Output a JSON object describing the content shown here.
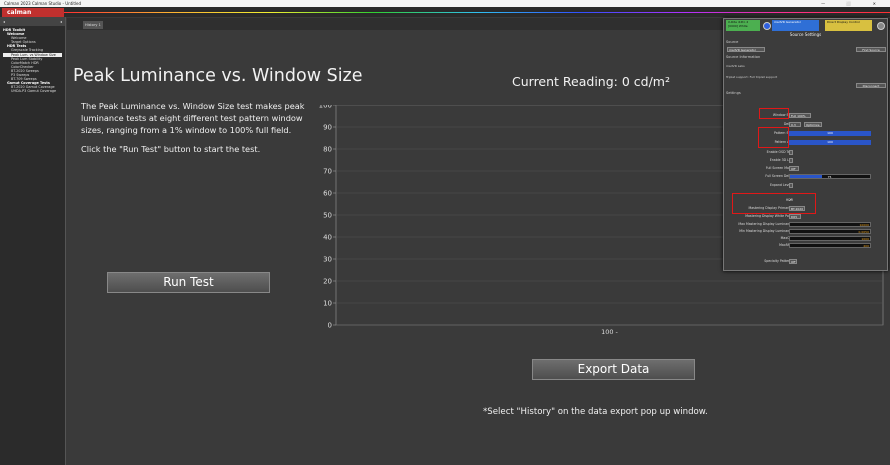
{
  "app": {
    "title": "Calman 2023 Calman Studio - Untitled",
    "logo": "calman",
    "window_controls": "— ⬜ ✕"
  },
  "sidebar": {
    "header": "HDR Toolkit",
    "items": [
      {
        "label": "HDR Toolkit",
        "level": 0,
        "bold": true
      },
      {
        "label": "Welcome",
        "level": 1,
        "bold": true
      },
      {
        "label": "Welcome",
        "level": 2
      },
      {
        "label": "Target Options",
        "level": 2
      },
      {
        "label": "HDR Tests",
        "level": 1,
        "bold": true
      },
      {
        "label": "Greyscale Tracking",
        "level": 2
      },
      {
        "label": "Peak Lum. vs Window Size",
        "level": 2,
        "selected": true
      },
      {
        "label": "Peak Lum Stability",
        "level": 2
      },
      {
        "label": "ColorMatch HDR",
        "level": 2
      },
      {
        "label": "ColorChecker",
        "level": 2
      },
      {
        "label": "BT.2020 Sweeps",
        "level": 2
      },
      {
        "label": "P3 Sweeps",
        "level": 2
      },
      {
        "label": "BT.709 Sweeps",
        "level": 2
      },
      {
        "label": "Gamut Coverage Tests",
        "level": 1,
        "bold": true
      },
      {
        "label": "BT.2020 Gamut Coverage",
        "level": 2
      },
      {
        "label": "UHDA-P3 Gamut Coverage",
        "level": 2
      }
    ]
  },
  "tabs": [
    {
      "label": "History 1"
    }
  ],
  "main": {
    "title": "Peak Luminance vs. Window Size",
    "description": "The Peak Luminance vs. Window Size test makes peak luminance tests at eight different test pattern window sizes, ranging from a 1% window to 100% full field.",
    "instruction": "Click the \"Run Test\" button to start the test.",
    "run_test_label": "Run Test",
    "reading": "Current Reading: 0 cd/m²",
    "export_label": "Export  Data",
    "footnote": "*Select \"History\" on the data export pop up window."
  },
  "chart_data": {
    "type": "line",
    "ylim": [
      0,
      100
    ],
    "yticks": [
      0,
      10,
      20,
      30,
      40,
      50,
      60,
      70,
      80,
      90,
      100
    ],
    "xticks": [
      "100 -"
    ],
    "series": [],
    "grid": true,
    "colors": {
      "grid": "#555555",
      "axis": "#9a9a9a",
      "text": "#dddddd"
    }
  },
  "panel": {
    "meter": {
      "line1": "X-Rite i1Pro 2",
      "line2": "[0000] White"
    },
    "generator": {
      "line1": "madVR Generator"
    },
    "display": {
      "line1": "Direct Display Control"
    },
    "title": "Source Settings",
    "source_label": "Source",
    "source_value": "madVR Generator",
    "find_source": "Find Source",
    "source_info_label": "Source Information",
    "source_info_1": "madVR Labs",
    "source_info_2": "Triplet support: Full triplet support",
    "disconnect": "Disconnect",
    "settings_label": "Settings",
    "rows": {
      "window_size": {
        "label": "Window Size",
        "value": "Full 100%"
      },
      "delay": {
        "label": "Delay",
        "value": "0.3",
        "btn": "Optimize"
      },
      "pattern_size": {
        "label": "Pattern Size",
        "value": "100"
      },
      "pattern_apl": {
        "label": "Pattern APL",
        "value": "100"
      },
      "enable_osd": {
        "label": "Enable OSD Text"
      },
      "enable_3dlut": {
        "label": "Enable 3D LUT"
      },
      "full_screen_mode": {
        "label": "Full Screen Mode",
        "value": "Off"
      },
      "full_screen_delay": {
        "label": "Full Screen Delay",
        "value": "75"
      },
      "expand_levels": {
        "label": "Expand Levels"
      },
      "hdr": {
        "label": "HDR",
        "value": "✔"
      },
      "mastering_primaries": {
        "label": "Mastering Display Primaries",
        "value": "BT.2020"
      },
      "mastering_white": {
        "label": "Mastering Display White Point",
        "value": "D65"
      },
      "max_lum": {
        "label": "Max Mastering Display Luminance",
        "value": "10000"
      },
      "min_lum": {
        "label": "Min Mastering Display Luminance",
        "value": "0.0050"
      },
      "maxcll": {
        "label": "MaxCLL",
        "value": "1000"
      },
      "maxfall": {
        "label": "MaxFALL",
        "value": "400"
      },
      "specialty": {
        "label": "Specialty Patterns",
        "value": "Off"
      }
    }
  }
}
